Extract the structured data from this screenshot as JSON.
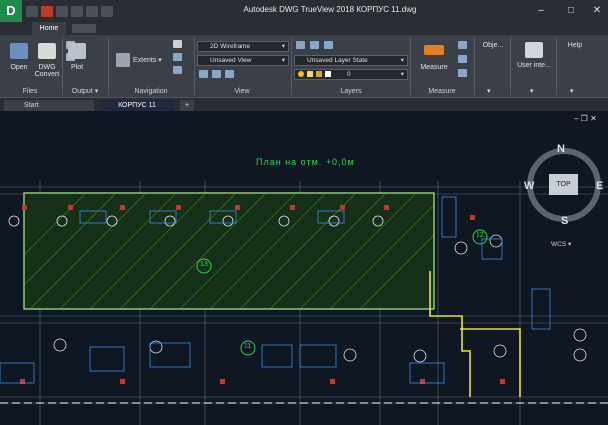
{
  "window": {
    "title": "Autodesk DWG TrueView 2018    КОРПУС 11.dwg",
    "app_logo": "D",
    "controls": {
      "minimize": "–",
      "maximize": "□",
      "close": "✕"
    }
  },
  "ribbon_tabs": {
    "home": "Home"
  },
  "ribbon": {
    "files": {
      "open": "Open",
      "dwg_convert": "DWG Convert",
      "label": "Files"
    },
    "output": {
      "plot": "Plot",
      "label": "Output ▾"
    },
    "navigation": {
      "extents": "Extents ▾",
      "label": "Navigation"
    },
    "view": {
      "visual_style": "2D Wireframe",
      "named_view": "Unsaved View",
      "label": "View"
    },
    "layers": {
      "layer_state": "Unsaved Layer State",
      "layer_current": "0",
      "label": "Layers"
    },
    "measure": {
      "measure": "Measure",
      "label": "Measure"
    },
    "objects": {
      "label": "Obje..."
    },
    "user_interface": {
      "label": "User inte..."
    },
    "help": {
      "label": "Help"
    }
  },
  "doc_tabs": {
    "start": "Start",
    "file": "КОРПУС 11",
    "add": "+"
  },
  "drawing": {
    "title_text": "План на отм. +0,0м",
    "viewport_controls": "– ❐ ✕",
    "grid_labels": [
      "12",
      "13",
      "11"
    ]
  },
  "viewcube": {
    "n": "N",
    "w": "W",
    "e": "E",
    "s": "S",
    "face": "TOP",
    "wcs": "WCS ▾"
  }
}
